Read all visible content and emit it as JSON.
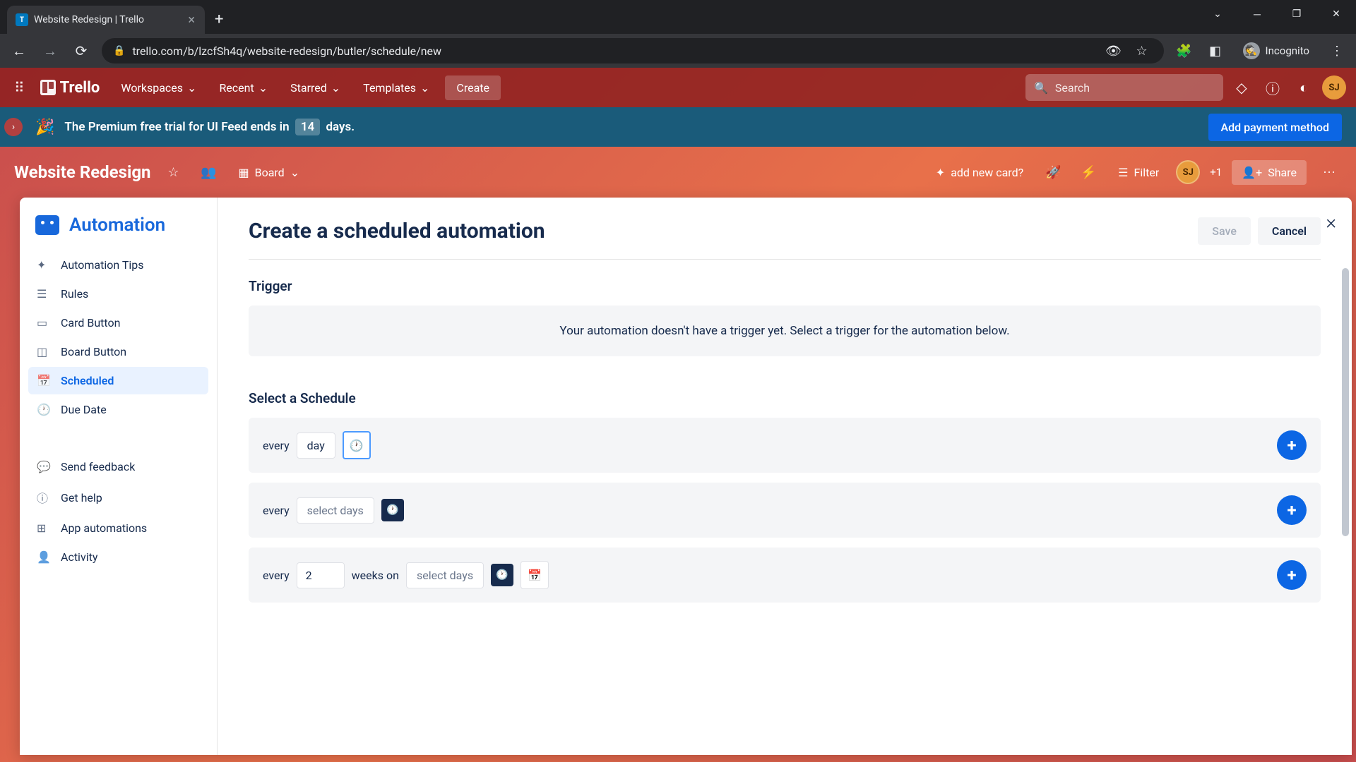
{
  "browser": {
    "tab_title": "Website Redesign | Trello",
    "url": "trello.com/b/lzcfSh4q/website-redesign/butler/schedule/new",
    "incognito_label": "Incognito"
  },
  "header": {
    "logo_text": "Trello",
    "nav": {
      "workspaces": "Workspaces",
      "recent": "Recent",
      "starred": "Starred",
      "templates": "Templates"
    },
    "create": "Create",
    "search_placeholder": "Search",
    "avatar_initials": "SJ"
  },
  "trial": {
    "text_prefix": "The Premium free trial for UI Feed ends in",
    "days": "14",
    "text_suffix": "days.",
    "add_payment": "Add payment method"
  },
  "board": {
    "name": "Website Redesign",
    "view_label": "Board",
    "add_card": "add new card?",
    "filter": "Filter",
    "member_initials": "SJ",
    "member_plus": "+1",
    "share": "Share"
  },
  "sidebar": {
    "title": "Automation",
    "items": {
      "tips": "Automation Tips",
      "rules": "Rules",
      "card_button": "Card Button",
      "board_button": "Board Button",
      "scheduled": "Scheduled",
      "due_date": "Due Date",
      "send_feedback": "Send feedback",
      "get_help": "Get help",
      "app_automations": "App automations",
      "activity": "Activity"
    }
  },
  "main": {
    "title": "Create a scheduled automation",
    "save": "Save",
    "cancel": "Cancel",
    "trigger_label": "Trigger",
    "trigger_empty": "Your automation doesn't have a trigger yet. Select a trigger for the automation below.",
    "schedule_label": "Select a Schedule",
    "row1": {
      "every": "every",
      "day": "day"
    },
    "row2": {
      "every": "every",
      "select_days": "select days"
    },
    "row3": {
      "every": "every",
      "value": "2",
      "weeks_on": "weeks on",
      "select_days": "select days"
    }
  }
}
